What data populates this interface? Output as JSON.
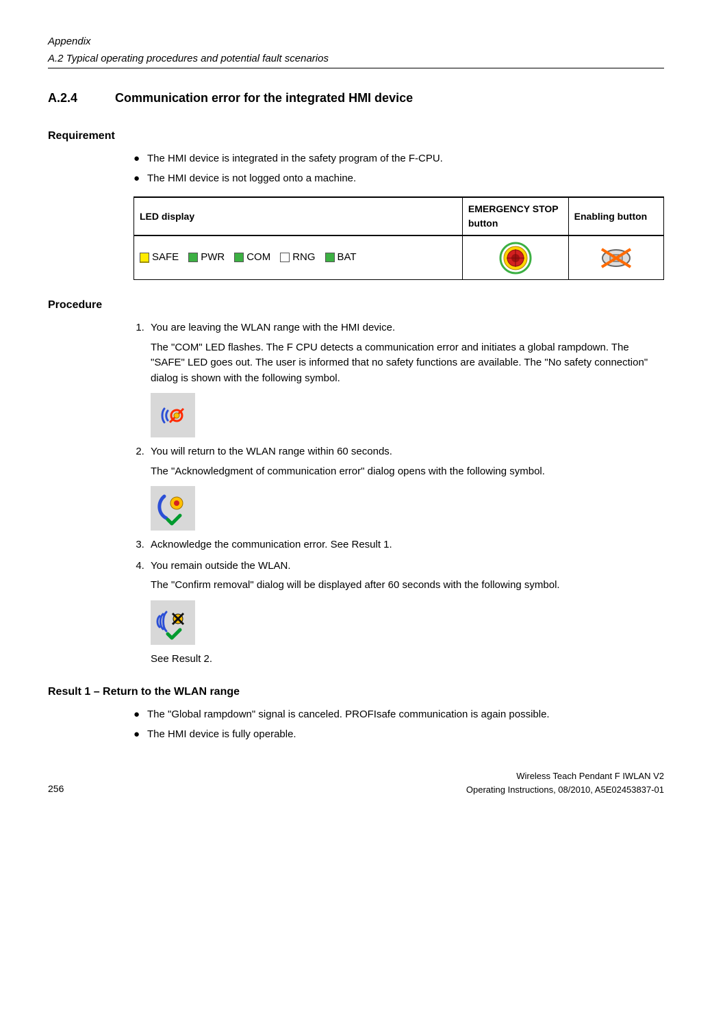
{
  "header": {
    "appendix": "Appendix",
    "subtitle": "A.2 Typical operating procedures and potential fault scenarios"
  },
  "section": {
    "number": "A.2.4",
    "title": "Communication error for the integrated HMI device"
  },
  "requirement": {
    "heading": "Requirement",
    "items": [
      "The HMI device is integrated in the safety program of the F-CPU.",
      "The HMI device is not logged onto a machine."
    ]
  },
  "table": {
    "headers": {
      "led": "LED display",
      "estop": "EMERGENCY STOP button",
      "enable": "Enabling button"
    },
    "leds": {
      "safe": "SAFE",
      "pwr": "PWR",
      "com": "COM",
      "rng": "RNG",
      "bat": "BAT"
    }
  },
  "procedure": {
    "heading": "Procedure",
    "step1": "You are leaving the WLAN range with the HMI device.",
    "step1_sub": "The \"COM\" LED flashes. The F CPU detects a communication error and initiates a global rampdown. The \"SAFE\" LED goes out. The user is informed that no safety functions are available. The \"No safety connection\" dialog is shown with the following symbol.",
    "step2": "You will return to the WLAN range within 60 seconds.",
    "step2_sub": "The \"Acknowledgment of communication error\" dialog opens with the following symbol.",
    "step3": "Acknowledge the communication error. See Result 1.",
    "step4": "You remain outside the WLAN.",
    "step4_sub": "The \"Confirm removal\" dialog will be displayed after 60 seconds with the following symbol.",
    "see_result2": "See Result 2."
  },
  "result1": {
    "heading": "Result 1 – Return to the WLAN range",
    "items": [
      "The \"Global rampdown\" signal is canceled. PROFIsafe communication is again possible.",
      "The HMI device is fully operable."
    ]
  },
  "footer": {
    "page": "256",
    "doc": "Wireless Teach Pendant F IWLAN V2",
    "info": "Operating Instructions, 08/2010, A5E02453837-01"
  }
}
